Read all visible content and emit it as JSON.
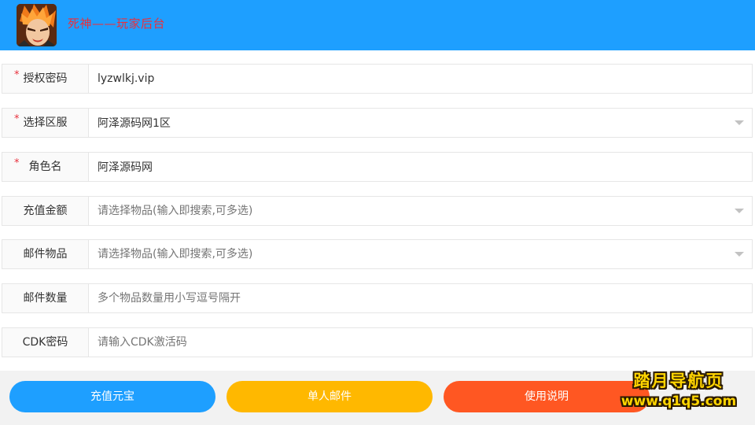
{
  "header": {
    "title": "死神——玩家后台",
    "avatar_icon": "character-portrait"
  },
  "form": {
    "auth_password": {
      "label": "授权密码",
      "required_mark": "*",
      "value": "lyzwlkj.vip",
      "placeholder": ""
    },
    "server": {
      "label": "选择区服",
      "required_mark": "*",
      "value": "阿泽源码网1区",
      "icon": "chevron-down-icon"
    },
    "role_name": {
      "label": "角色名",
      "required_mark": "*",
      "value": "阿泽源码网",
      "placeholder": ""
    },
    "recharge_amount": {
      "label": "充值金额",
      "value": "",
      "placeholder": "请选择物品(输入即搜索,可多选)",
      "icon": "chevron-down-icon"
    },
    "mail_items": {
      "label": "邮件物品",
      "value": "",
      "placeholder": "请选择物品(输入即搜索,可多选)",
      "icon": "chevron-down-icon"
    },
    "mail_quantity": {
      "label": "邮件数量",
      "value": "",
      "placeholder": "多个物品数量用小写逗号隔开"
    },
    "cdk_code": {
      "label": "CDK密码",
      "value": "",
      "placeholder": "请输入CDK激活码"
    }
  },
  "actions": {
    "recharge_label": "充值元宝",
    "mail_label": "单人邮件",
    "help_label": "使用说明"
  },
  "watermark": {
    "line1": "踏月导航页",
    "line2": "www.q1q5.com"
  },
  "colors": {
    "header_bg": "#1e9fff",
    "title_text": "#e8303c",
    "required": "#e8303c",
    "btn_recharge": "#1e9fff",
    "btn_mail": "#ffb800",
    "btn_help": "#ff5722",
    "footer_bg": "#f2f2f2",
    "watermark": "#ffd400"
  }
}
